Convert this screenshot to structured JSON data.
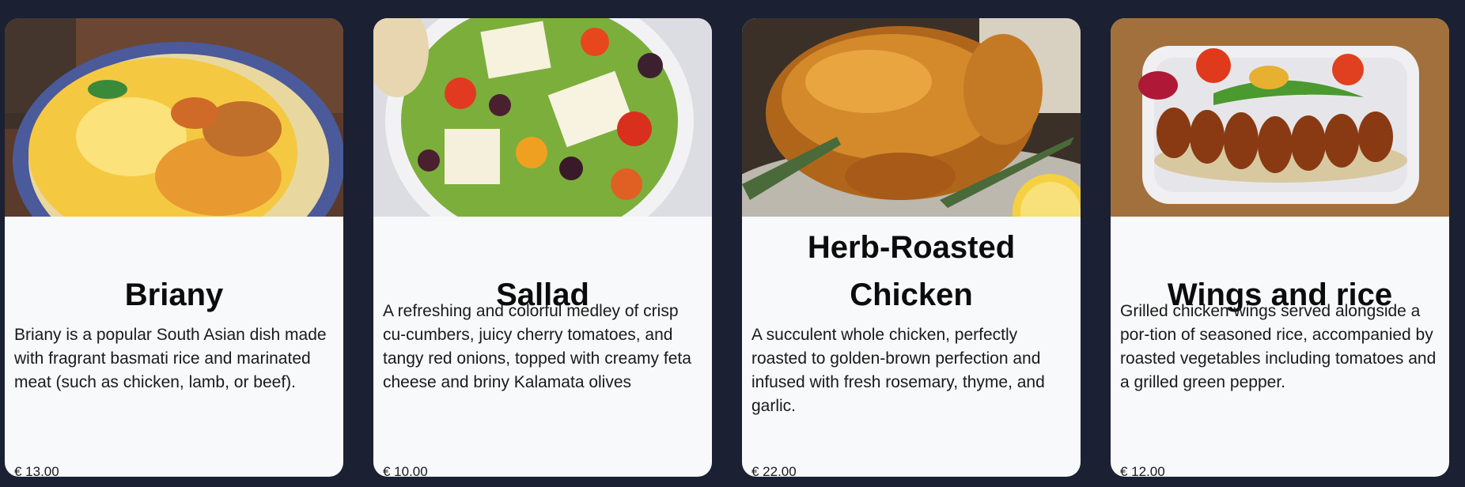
{
  "cards": [
    {
      "title": "Briany",
      "description": "Briany is a popular South Asian dish made with fragrant basmati rice and marinated meat (such as chicken, lamb, or beef).",
      "price": "€ 13.00",
      "image": "biryani-photo"
    },
    {
      "title": "Sallad",
      "description": "A refreshing and colorful medley of crisp cu-cumbers, juicy cherry tomatoes, and tangy red onions, topped with creamy feta cheese and briny Kalamata olives",
      "price": "€ 10.00",
      "image": "greek-salad-photo"
    },
    {
      "title": "Herb-Roasted Chicken",
      "description": "A succulent whole chicken, perfectly roasted to golden-brown perfection and infused with fresh rosemary, thyme, and garlic.",
      "price": "€ 22.00",
      "image": "roast-chicken-photo"
    },
    {
      "title": "Wings and rice",
      "description": "Grilled chicken wings served alongside a por-tion of seasoned rice, accompanied by roasted vegetables including tomatoes and a grilled green pepper.",
      "price": "€ 12.00",
      "image": "wings-and-rice-photo"
    }
  ]
}
